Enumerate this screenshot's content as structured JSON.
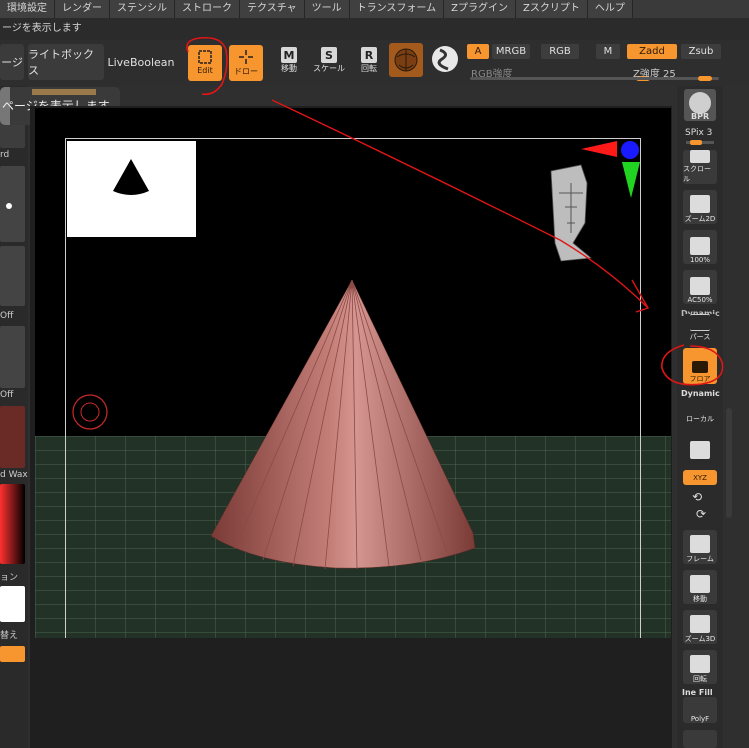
{
  "menu": [
    "環境設定",
    "レンダー",
    "ステンシル",
    "ストローク",
    "テクスチャ",
    "ツール",
    "トランスフォーム",
    "Zプラグイン",
    "Zスクリプト",
    "ヘルプ"
  ],
  "subline": "ージを表示します",
  "toolbar": {
    "page_btn": "ージ",
    "lightbox": "ライトボックス",
    "liveboolean": "LiveBoolean",
    "edit": "Edit",
    "draw": "ドロー",
    "move": "移動",
    "scale": "スケール",
    "rotate": "回転",
    "move_key": "M",
    "scale_key": "S",
    "rotate_key": "R",
    "a": "A",
    "mrgb": "MRGB",
    "rgb": "RGB",
    "m": "M",
    "zadd": "Zadd",
    "zsub": "Zsub",
    "rgb_intensity": "RGB強度",
    "z_intensity_label": "Z強度",
    "z_intensity_value": "25"
  },
  "tooltip": "ページを表示します",
  "left_panel": {
    "label1": "rd",
    "label2": "Off",
    "label3": "Off",
    "label4": "d Wax",
    "label5": "ョン",
    "label6": "替え"
  },
  "right_panel": {
    "bpr": "BPR",
    "spix": "SPix 3",
    "scroll": "スクロール",
    "zoom2d": "ズーム2D",
    "p100": "100%",
    "ac50": "AC50%",
    "dynamic": "Dynamic",
    "perspective": "パース",
    "floor": "フロア",
    "dynamic2": "Dynamic",
    "local": "ローカル",
    "xyz": "XYZ",
    "frame": "フレーム",
    "move": "移動",
    "zoom3d": "ズーム3D",
    "rotate": "回転",
    "line_fill": "Ine Fill",
    "polyf": "PolyF"
  },
  "colors": {
    "accent": "#f7952f",
    "annotation": "#e01515",
    "cone": "#b86a64",
    "floor": "#233226",
    "viewport": "#000000"
  }
}
